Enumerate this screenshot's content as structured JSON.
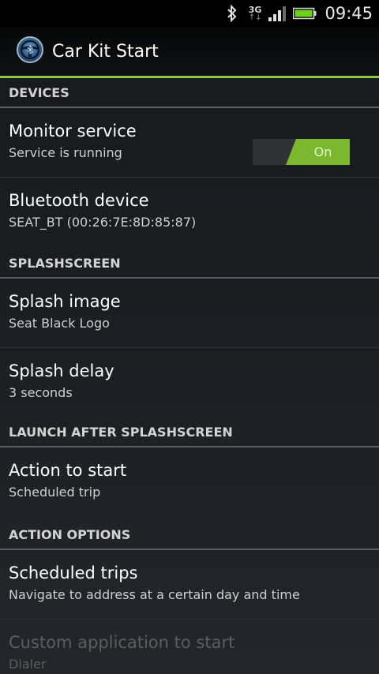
{
  "status_bar": {
    "network_type": "3G",
    "time": "09:45",
    "icons": [
      "bluetooth-icon",
      "network-3g-icon",
      "signal-icon",
      "battery-icon"
    ],
    "battery_color": "#6dd21e"
  },
  "app": {
    "title": "Car Kit Start",
    "icon": "steering-wheel-icon",
    "accent_color": "#8fc63f"
  },
  "sections": {
    "devices": "DEVICES",
    "splashscreen": "SPLASHSCREEN",
    "launch": "LAUNCH AFTER SPLASHSCREEN",
    "action_options": "ACTION OPTIONS"
  },
  "prefs": {
    "monitor": {
      "title": "Monitor service",
      "summary": "Service is running",
      "toggle_label": "On"
    },
    "bluetooth": {
      "title": "Bluetooth device",
      "summary": "SEAT_BT (00:26:7E:8D:85:87)"
    },
    "splash_image": {
      "title": "Splash image",
      "summary": "Seat Black Logo"
    },
    "splash_delay": {
      "title": "Splash delay",
      "summary": "3 seconds"
    },
    "action": {
      "title": "Action to start",
      "summary": "Scheduled trip"
    },
    "scheduled": {
      "title": "Scheduled trips",
      "summary": "Navigate to address at a certain day and time"
    },
    "custom_app": {
      "title": "Custom application to start",
      "summary": "Dialer"
    }
  }
}
